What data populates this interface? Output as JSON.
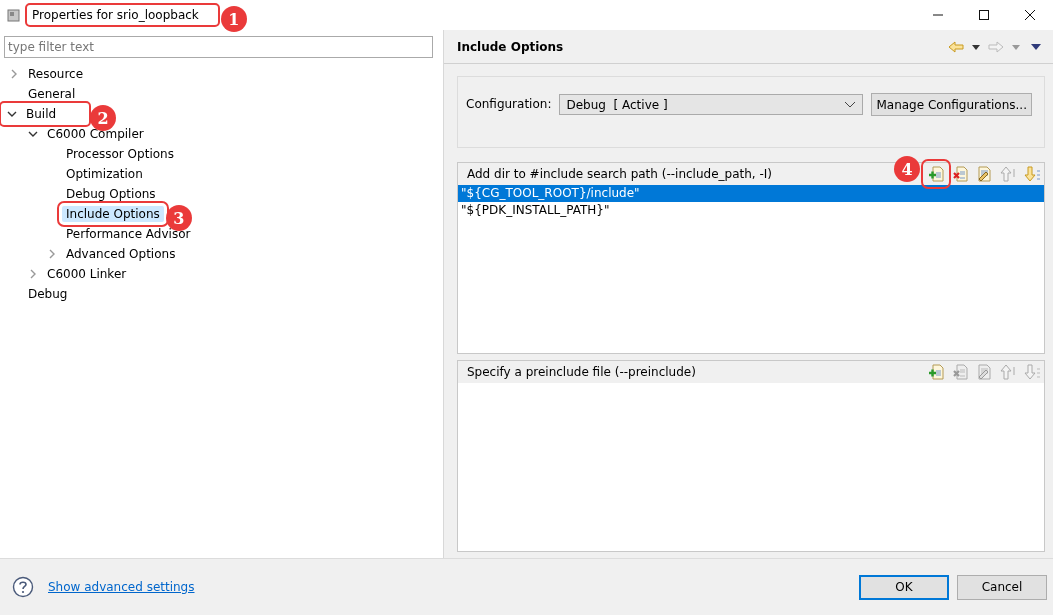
{
  "window": {
    "title": "Properties for srio_loopback",
    "annotation": "1"
  },
  "filter": {
    "placeholder": "type filter text"
  },
  "tree": [
    {
      "label": "Resource",
      "expanded": false,
      "has_children": true,
      "selected": false
    },
    {
      "label": "General",
      "selected": false
    },
    {
      "label": "Build",
      "expanded": true,
      "has_children": true,
      "selected": false,
      "annotation": "2",
      "children": [
        {
          "label": "C6000 Compiler",
          "expanded": true,
          "has_children": true,
          "selected": false,
          "children": [
            {
              "label": "Processor Options",
              "selected": false
            },
            {
              "label": "Optimization",
              "selected": false
            },
            {
              "label": "Debug Options",
              "selected": false
            },
            {
              "label": "Include Options",
              "selected": true,
              "annotation": "3"
            },
            {
              "label": "Performance Advisor",
              "selected": false
            },
            {
              "label": "Advanced Options",
              "expanded": false,
              "has_children": true,
              "selected": false
            }
          ]
        },
        {
          "label": "C6000 Linker",
          "expanded": false,
          "has_children": true,
          "selected": false
        }
      ]
    },
    {
      "label": "Debug",
      "selected": false
    }
  ],
  "page": {
    "title": "Include Options"
  },
  "configuration": {
    "label": "Configuration:",
    "value": "Debug  [ Active ]",
    "button": "Manage Configurations..."
  },
  "lists": [
    {
      "title": "Add dir to #include search path (--include_path, -I)",
      "tools": [
        {
          "kind": "add",
          "disabled": false,
          "annotation": "4"
        },
        {
          "kind": "delete",
          "disabled": false
        },
        {
          "kind": "edit",
          "disabled": false
        },
        {
          "kind": "up",
          "disabled": true
        },
        {
          "kind": "down",
          "disabled": false
        }
      ],
      "items": [
        {
          "text": "\"${CG_TOOL_ROOT}/include\"",
          "selected": true
        },
        {
          "text": "\"${PDK_INSTALL_PATH}\"",
          "selected": false
        }
      ]
    },
    {
      "title": "Specify a preinclude file (--preinclude)",
      "tools": [
        {
          "kind": "add",
          "disabled": false
        },
        {
          "kind": "delete",
          "disabled": true
        },
        {
          "kind": "edit",
          "disabled": true
        },
        {
          "kind": "up",
          "disabled": true
        },
        {
          "kind": "down",
          "disabled": true
        }
      ]
    }
  ],
  "footer": {
    "link": "Show advanced settings",
    "buttons": [
      {
        "label": "OK",
        "default": true
      },
      {
        "label": "Cancel",
        "default": false
      }
    ]
  }
}
